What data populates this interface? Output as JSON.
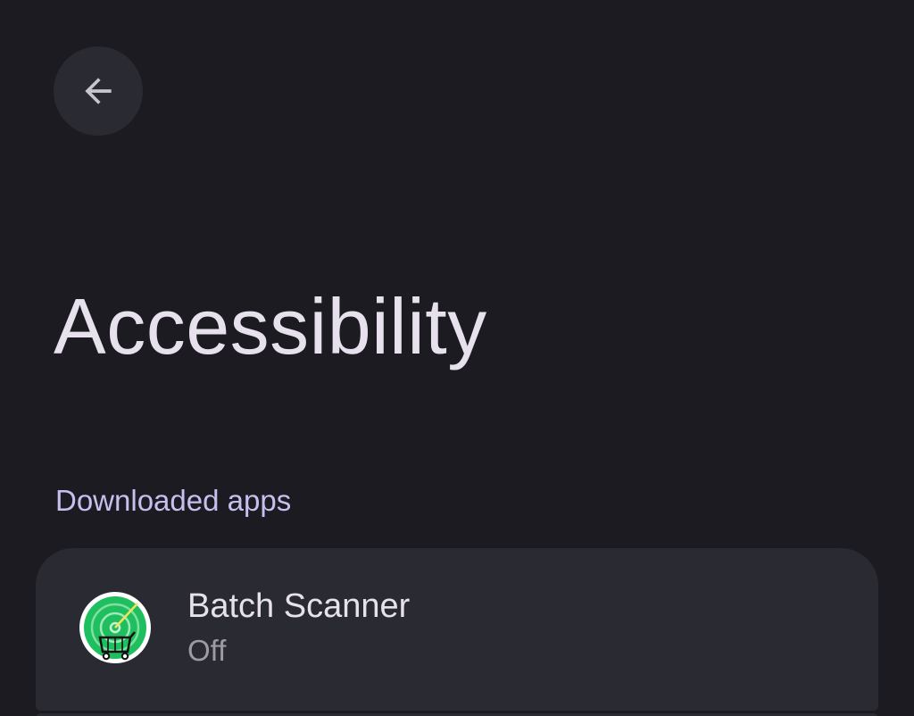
{
  "header": {
    "back_icon": "arrow-left-icon"
  },
  "page": {
    "title": "Accessibility"
  },
  "sections": {
    "downloaded_apps": {
      "header": "Downloaded apps",
      "items": [
        {
          "name": "Batch Scanner",
          "status": "Off",
          "icon": "batch-scanner-radar-icon"
        }
      ]
    }
  },
  "colors": {
    "background": "#1b1b21",
    "surface": "#2a2a32",
    "title_text": "#e6e1ec",
    "accent_text": "#c5c0ee",
    "secondary_text": "#9e9aa6",
    "icon_green": "#1fbf5f"
  }
}
